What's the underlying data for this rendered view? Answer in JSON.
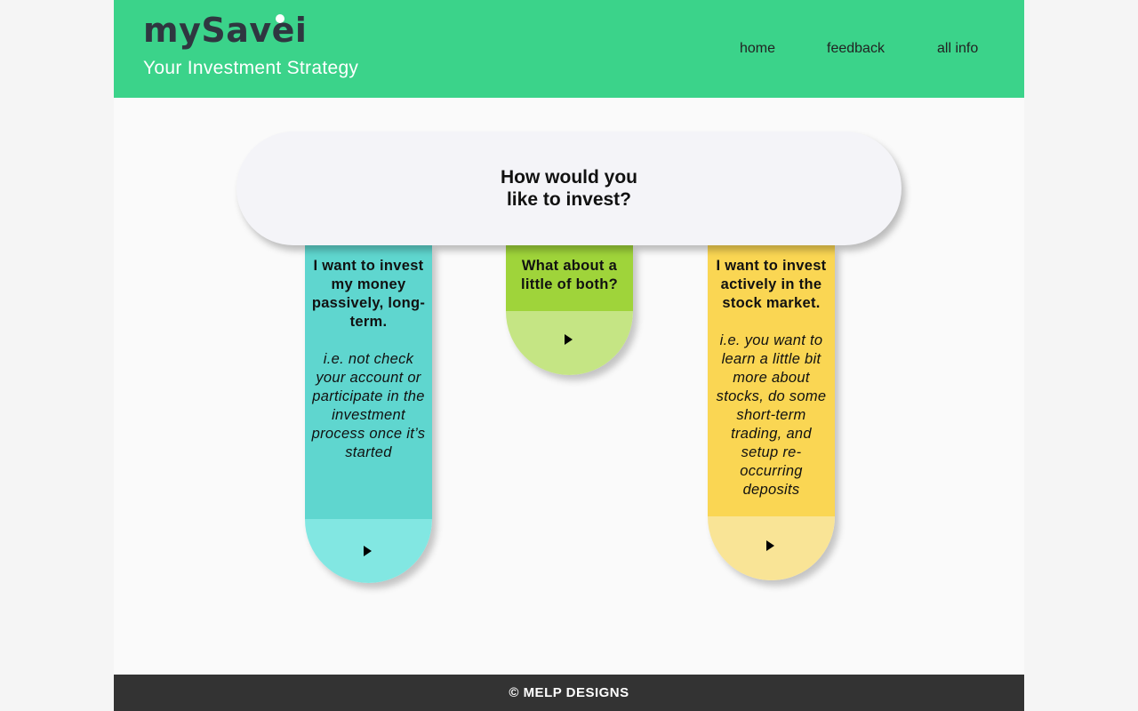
{
  "header": {
    "logo": "mySavei",
    "tagline": "Your Investment Strategy",
    "nav": [
      {
        "label": "home"
      },
      {
        "label": "feedback"
      },
      {
        "label": "all info"
      }
    ],
    "color": "#3bd38a"
  },
  "question": {
    "line1": "How would you",
    "line2": "like to invest?"
  },
  "options": [
    {
      "title": "I want to invest my money passively, long-term.",
      "description": "i.e. not check your account or participate in the investment process once it’s started",
      "color": "#5fd6cf",
      "button_icon": "play-icon"
    },
    {
      "title": "What about a little of both?",
      "description": "",
      "color": "#9fd43a",
      "button_icon": "play-icon"
    },
    {
      "title": "I want to invest actively in the stock market.",
      "description": "i.e. you want to learn a little bit more about stocks, do some short-term trading, and setup re-occurring deposits",
      "color": "#fad653",
      "button_icon": "play-icon"
    }
  ],
  "footer": {
    "text": "© MELP DESIGNS"
  }
}
